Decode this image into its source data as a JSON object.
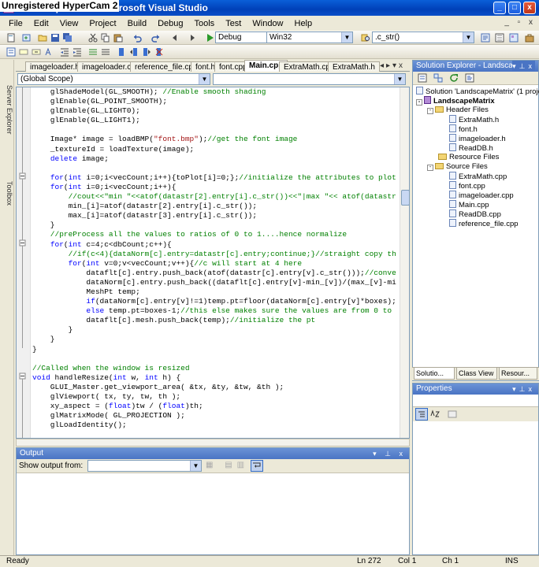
{
  "window": {
    "overlay_text": "Unregistered HyperCam 2",
    "title": "LandscapeMatrix - Microsoft Visual Studio",
    "buttons": {
      "minimize": "_",
      "maximize": "□",
      "close": "x"
    }
  },
  "menu": [
    "File",
    "Edit",
    "View",
    "Project",
    "Build",
    "Debug",
    "Tools",
    "Test",
    "Window",
    "Help"
  ],
  "toolbar": {
    "configuration": "Debug",
    "platform": "Win32",
    "find_combo": ".c_str()"
  },
  "left_dock": {
    "server_explorer": "Server Explorer",
    "toolbox": "Toolbox"
  },
  "editor": {
    "tabs": [
      "imageloader.h",
      "imageloader.cpp",
      "reference_file.cpp",
      "font.h",
      "font.cpp",
      "Main.cpp",
      "ExtraMath.cpp",
      "ExtraMath.h"
    ],
    "active_tab": "Main.cpp",
    "scope": "(Global Scope)",
    "code_lines": [
      [
        {
          "t": "    glShadeModel(GL_SMOOTH); ",
          "c": ""
        },
        {
          "t": "//Enable smooth shading",
          "c": "cm"
        }
      ],
      [
        {
          "t": "    glEnable(GL_POINT_SMOOTH);",
          "c": ""
        }
      ],
      [
        {
          "t": "    glEnable(GL_LIGHT0);",
          "c": ""
        }
      ],
      [
        {
          "t": "    glEnable(GL_LIGHT1);",
          "c": ""
        }
      ],
      [
        {
          "t": "",
          "c": ""
        }
      ],
      [
        {
          "t": "    Image* image = loadBMP(",
          "c": ""
        },
        {
          "t": "\"font.bmp\"",
          "c": "st"
        },
        {
          "t": ");",
          "c": ""
        },
        {
          "t": "//get the font image",
          "c": "cm"
        }
      ],
      [
        {
          "t": "    _textureId = loadTexture(image);",
          "c": ""
        }
      ],
      [
        {
          "t": "    ",
          "c": ""
        },
        {
          "t": "delete",
          "c": "kw"
        },
        {
          "t": " image;",
          "c": ""
        }
      ],
      [
        {
          "t": "",
          "c": ""
        }
      ],
      [
        {
          "t": "    ",
          "c": ""
        },
        {
          "t": "for",
          "c": "kw"
        },
        {
          "t": "(",
          "c": ""
        },
        {
          "t": "int",
          "c": "kw"
        },
        {
          "t": " i=0;i<vecCount;i++){toPlot[i]=0;};",
          "c": ""
        },
        {
          "t": "//initialize the attributes to plot",
          "c": "cm"
        }
      ],
      [
        {
          "t": "    ",
          "c": ""
        },
        {
          "t": "for",
          "c": "kw"
        },
        {
          "t": "(",
          "c": ""
        },
        {
          "t": "int",
          "c": "kw"
        },
        {
          "t": " i=0;i<vecCount;i++){",
          "c": ""
        }
      ],
      [
        {
          "t": "        //cout<<\"min \"<<atof(datastr[2].entry[i].c_str())<<\"|max \"<< atof(datastr",
          "c": "cm"
        }
      ],
      [
        {
          "t": "        min_[i]=atof(datastr[2].entry[i].c_str());",
          "c": ""
        }
      ],
      [
        {
          "t": "        max_[i]=atof(datastr[3].entry[i].c_str());",
          "c": ""
        }
      ],
      [
        {
          "t": "    }",
          "c": ""
        }
      ],
      [
        {
          "t": "    //preProcess all the values to ratios of 0 to 1....hence normalize",
          "c": "cm"
        }
      ],
      [
        {
          "t": "    ",
          "c": ""
        },
        {
          "t": "for",
          "c": "kw"
        },
        {
          "t": "(",
          "c": ""
        },
        {
          "t": "int",
          "c": "kw"
        },
        {
          "t": " c=4;c<dbCount;c++){",
          "c": ""
        }
      ],
      [
        {
          "t": "        //if(c<4){dataNorm[c].entry=datastr[c].entry;continue;}//straight copy th",
          "c": "cm"
        }
      ],
      [
        {
          "t": "        ",
          "c": ""
        },
        {
          "t": "for",
          "c": "kw"
        },
        {
          "t": "(",
          "c": ""
        },
        {
          "t": "int",
          "c": "kw"
        },
        {
          "t": " v=0;v<vecCount;v++){",
          "c": ""
        },
        {
          "t": "//c will start at 4 here",
          "c": "cm"
        }
      ],
      [
        {
          "t": "            dataflt[c].entry.push_back(atof(datastr[c].entry[v].c_str()));",
          "c": ""
        },
        {
          "t": "//conve",
          "c": "cm"
        }
      ],
      [
        {
          "t": "            dataNorm[c].entry.push_back((dataflt[c].entry[v]-min_[v])/(max_[v]-mi",
          "c": ""
        }
      ],
      [
        {
          "t": "            MeshPt temp;",
          "c": ""
        }
      ],
      [
        {
          "t": "            ",
          "c": ""
        },
        {
          "t": "if",
          "c": "kw"
        },
        {
          "t": "(dataNorm[c].entry[v]!=1)temp.pt=floor(dataNorm[c].entry[v]*boxes);",
          "c": ""
        }
      ],
      [
        {
          "t": "            ",
          "c": ""
        },
        {
          "t": "else",
          "c": "kw"
        },
        {
          "t": " temp.pt=boxes-1;",
          "c": ""
        },
        {
          "t": "//this else makes sure the values are from 0 to",
          "c": "cm"
        }
      ],
      [
        {
          "t": "            dataflt[c].mesh.push_back(temp);",
          "c": ""
        },
        {
          "t": "//initialize the pt",
          "c": "cm"
        }
      ],
      [
        {
          "t": "        }",
          "c": ""
        }
      ],
      [
        {
          "t": "    }",
          "c": ""
        }
      ],
      [
        {
          "t": "}",
          "c": ""
        }
      ],
      [
        {
          "t": "",
          "c": ""
        }
      ],
      [
        {
          "t": "//Called when the window is resized",
          "c": "cm"
        }
      ],
      [
        {
          "t": "void",
          "c": "kw"
        },
        {
          "t": " handleResize(",
          "c": ""
        },
        {
          "t": "int",
          "c": "kw"
        },
        {
          "t": " w, ",
          "c": ""
        },
        {
          "t": "int",
          "c": "kw"
        },
        {
          "t": " h) {",
          "c": ""
        }
      ],
      [
        {
          "t": "    GLUI_Master.get_viewport_area( &tx, &ty, &tw, &th );",
          "c": ""
        }
      ],
      [
        {
          "t": "    glViewport( tx, ty, tw, th );",
          "c": ""
        }
      ],
      [
        {
          "t": "    xy_aspect = (",
          "c": ""
        },
        {
          "t": "float",
          "c": "kw"
        },
        {
          "t": ")tw / (",
          "c": ""
        },
        {
          "t": "float",
          "c": "kw"
        },
        {
          "t": ")th;",
          "c": ""
        }
      ],
      [
        {
          "t": "    glMatrixMode( GL_PROJECTION );",
          "c": ""
        }
      ],
      [
        {
          "t": "    glLoadIdentity();",
          "c": ""
        }
      ]
    ]
  },
  "output": {
    "title": "Output",
    "show_output_label": "Show output from:"
  },
  "solution_explorer": {
    "title": "Solution Explorer - LandscapeM...",
    "solution": "Solution 'LandscapeMatrix' (1 project)",
    "project": "LandscapeMatrix",
    "header_folder": "Header Files",
    "headers": [
      "ExtraMath.h",
      "font.h",
      "imageloader.h",
      "ReadDB.h"
    ],
    "resource_folder": "Resource Files",
    "source_folder": "Source Files",
    "sources": [
      "ExtraMath.cpp",
      "font.cpp",
      "imageloader.cpp",
      "Main.cpp",
      "ReadDB.cpp",
      "reference_file.cpp"
    ],
    "tabs": [
      "Solutio...",
      "Class View",
      "Resour..."
    ]
  },
  "properties": {
    "title": "Properties"
  },
  "status": {
    "ready": "Ready",
    "line": "Ln 272",
    "col": "Col 1",
    "ch": "Ch 1",
    "ins": "INS"
  }
}
